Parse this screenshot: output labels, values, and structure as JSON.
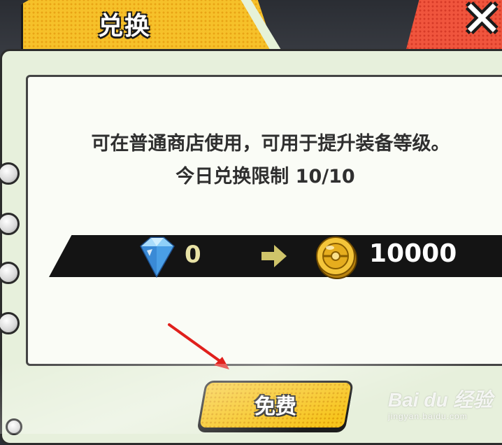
{
  "header": {
    "title": "兑换"
  },
  "close": {
    "glyph": "✕",
    "icon": "close-icon"
  },
  "panel": {
    "description": "可在普通商店使用，可用于提升装备等级。",
    "limit_text": "今日兑换限制 10/10"
  },
  "exchange": {
    "cost_icon": "diamond-icon",
    "cost_value": "0",
    "arrow_icon": "arrow-right-icon",
    "reward_icon": "gold-coin-icon",
    "reward_value": "10000"
  },
  "action": {
    "free_label": "免费"
  },
  "watermark": {
    "brand": "Bai du 经验",
    "url": "jingyan.baidu.com"
  },
  "colors": {
    "accent_yellow": "#f6c12a",
    "close_red": "#f0553d",
    "panel_bg": "#e7f0dc"
  }
}
